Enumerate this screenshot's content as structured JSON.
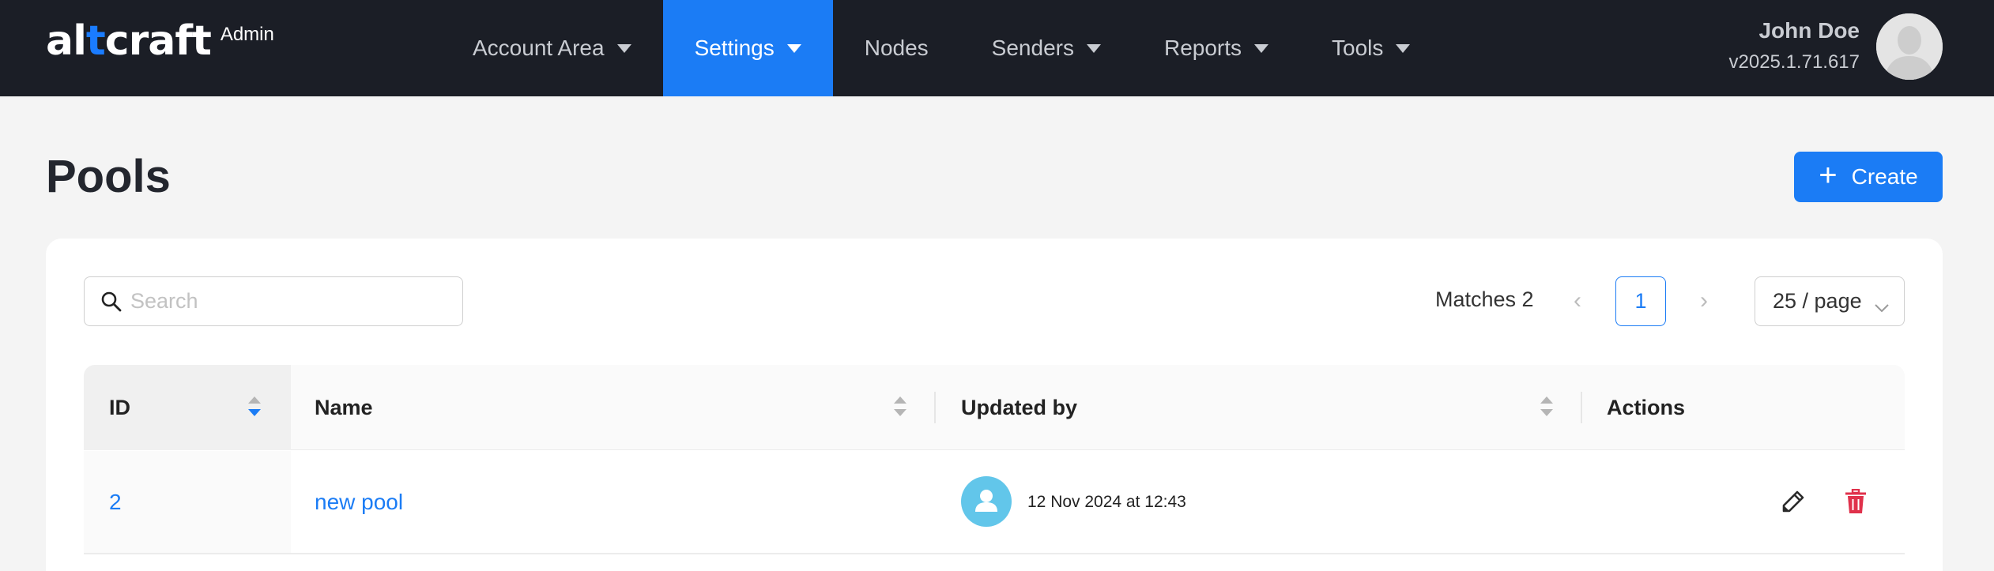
{
  "header": {
    "logo": {
      "text_before": "al",
      "text_accent": "t",
      "text_after": "craft",
      "badge": "Admin"
    },
    "nav": [
      {
        "label": "Account Area",
        "dropdown": true,
        "active": false
      },
      {
        "label": "Settings",
        "dropdown": true,
        "active": true
      },
      {
        "label": "Nodes",
        "dropdown": false,
        "active": false
      },
      {
        "label": "Senders",
        "dropdown": true,
        "active": false
      },
      {
        "label": "Reports",
        "dropdown": true,
        "active": false
      },
      {
        "label": "Tools",
        "dropdown": true,
        "active": false
      }
    ],
    "user": {
      "name": "John Doe",
      "version": "v2025.1.71.617",
      "avatar_icon": "user-avatar-icon"
    }
  },
  "page": {
    "title": "Pools",
    "create_label": "Create",
    "create_icon": "plus-icon"
  },
  "toolbar": {
    "search_placeholder": "Search",
    "search_value": "",
    "matches": "Matches 2",
    "current_page": "1",
    "page_size": "25 / page"
  },
  "table": {
    "columns": [
      "ID",
      "Name",
      "Updated by",
      "Actions"
    ],
    "rows": [
      {
        "id": "2",
        "name": "new pool",
        "updated": "12 Nov 2024 at 12:43"
      }
    ]
  },
  "colors": {
    "nav_bg": "#1b1e26",
    "accent": "#1b7cf5",
    "delete": "#e0314b",
    "avatar_bg": "#62c6ea"
  }
}
